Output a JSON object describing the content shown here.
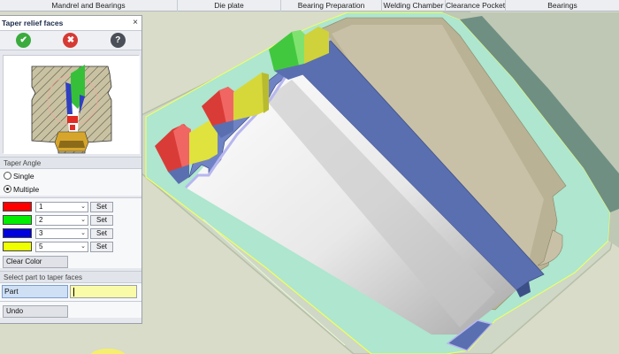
{
  "ribbon": {
    "tabs": [
      "Mandrel and Bearings",
      "Die plate",
      "Bearing Preparation",
      "Welding Chamber",
      "Clearance Pocket",
      "Bearings"
    ]
  },
  "panel": {
    "title": "Taper relief faces",
    "close": "×",
    "ok_icon": "✔",
    "cancel_icon": "✖",
    "help_icon": "?",
    "taper_angle_title": "Taper Angle",
    "single_label": "Single",
    "multiple_label": "Multiple",
    "selected_mode": "Multiple",
    "colors": [
      {
        "color": "#ff0000",
        "value": "1",
        "set": "Set"
      },
      {
        "color": "#00ee00",
        "value": "2",
        "set": "Set"
      },
      {
        "color": "#0000dd",
        "value": "3",
        "set": "Set"
      },
      {
        "color": "#eeff00",
        "value": "5",
        "set": "Set"
      }
    ],
    "clear_color": "Clear Color",
    "select_part_title": "Select part to taper faces",
    "part_label": "Part",
    "part_value": "",
    "undo": "Undo"
  },
  "icons": {
    "combo_arrow": "⌄"
  }
}
